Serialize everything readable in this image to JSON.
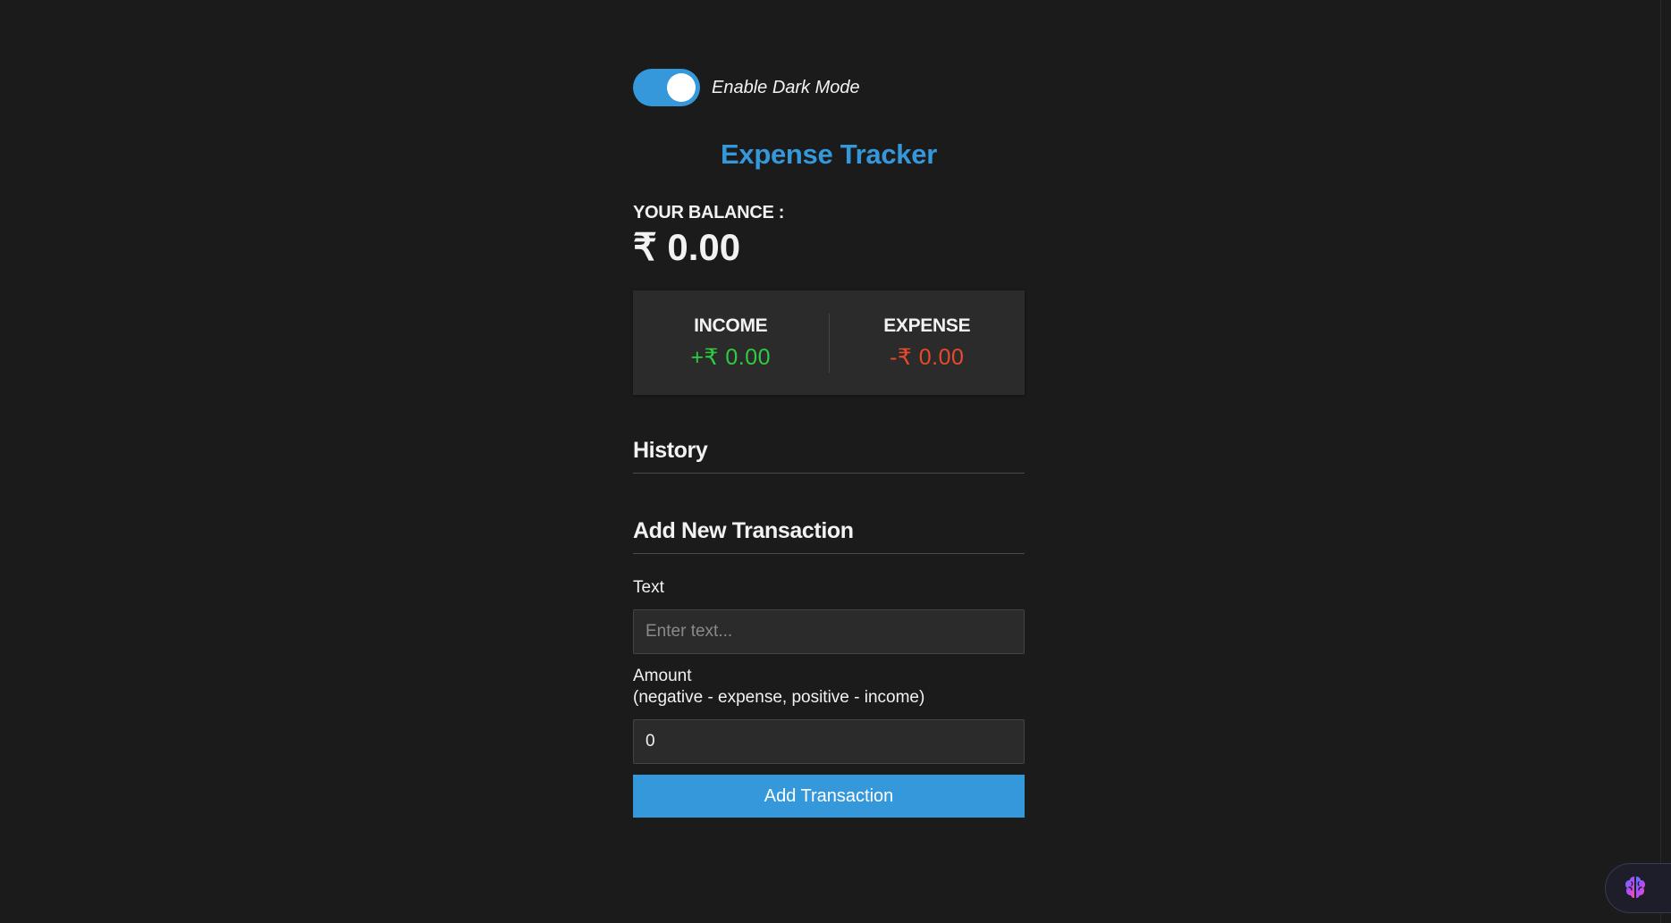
{
  "dark_mode": {
    "label": "Enable Dark Mode",
    "enabled": true
  },
  "app": {
    "title": "Expense Tracker"
  },
  "balance": {
    "label": "YOUR BALANCE :",
    "value": "₹ 0.00"
  },
  "summary": {
    "income_label": "INCOME",
    "income_value": "+₹ 0.00",
    "expense_label": "EXPENSE",
    "expense_value": "-₹ 0.00"
  },
  "history": {
    "heading": "History",
    "items": []
  },
  "form": {
    "heading": "Add New Transaction",
    "text_label": "Text",
    "text_placeholder": "Enter text...",
    "text_value": "",
    "amount_label": "Amount",
    "amount_hint": "(negative - expense, positive - income)",
    "amount_value": "0",
    "submit_label": "Add Transaction"
  },
  "colors": {
    "background": "#1b1b1b",
    "accent": "#3498db",
    "income": "#2ecc40",
    "expense": "#e84a2b"
  },
  "icons": {
    "extension_widget": "brain-icon"
  }
}
